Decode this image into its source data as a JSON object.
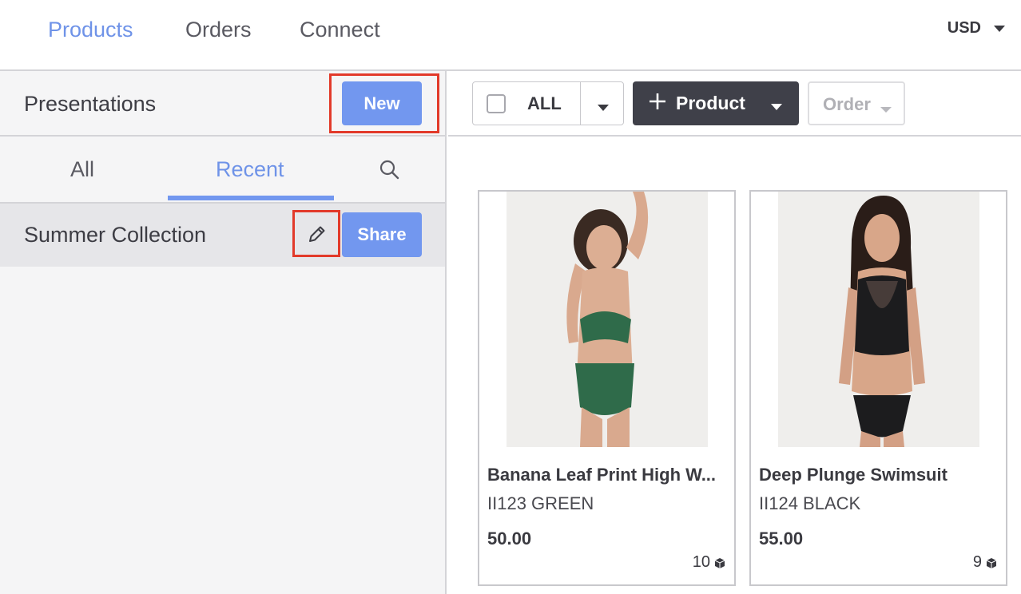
{
  "nav": {
    "items": [
      {
        "label": "Products",
        "active": true
      },
      {
        "label": "Orders",
        "active": false
      },
      {
        "label": "Connect",
        "active": false
      }
    ],
    "currency": "USD"
  },
  "sidebar": {
    "title": "Presentations",
    "new_label": "New",
    "tabs": [
      {
        "label": "All",
        "active": false
      },
      {
        "label": "Recent",
        "active": true
      }
    ],
    "rows": [
      {
        "label": "Summer Collection",
        "share_label": "Share"
      }
    ]
  },
  "toolbar": {
    "select_all_label": "ALL",
    "product_label": "Product",
    "order_label": "Order"
  },
  "products": [
    {
      "name": "Banana Leaf Print High W...",
      "sku": "II123 GREEN",
      "price": "50.00",
      "stock": "10",
      "swim_color": "#2f6b4a"
    },
    {
      "name": "Deep Plunge Swimsuit",
      "sku": "II124 BLACK",
      "price": "55.00",
      "stock": "9",
      "swim_color": "#1c1c1e"
    }
  ],
  "colors": {
    "accent": "#7297ef",
    "highlight": "#e23a2a",
    "dark_button": "#3f4049"
  },
  "icons": [
    "search-icon",
    "pencil-icon",
    "plus-icon",
    "chevron-down-icon",
    "box-icon",
    "checkbox-icon"
  ]
}
